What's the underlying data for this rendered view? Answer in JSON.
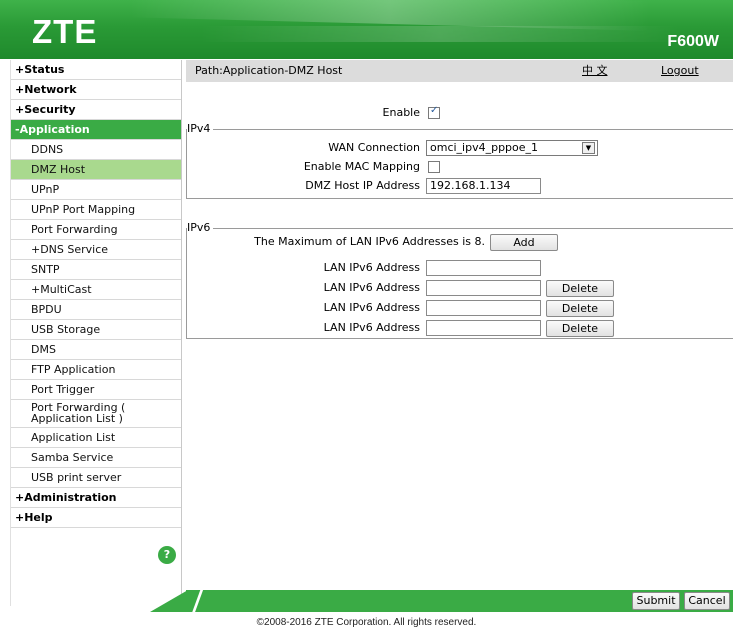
{
  "header": {
    "logo": "ZTE",
    "model": "F600W"
  },
  "sidebar": {
    "items": [
      {
        "label": "+Status",
        "level": "top"
      },
      {
        "label": "+Network",
        "level": "top"
      },
      {
        "label": "+Security",
        "level": "top"
      },
      {
        "label": "-Application",
        "level": "top",
        "active": true
      },
      {
        "label": "DDNS",
        "level": "sub"
      },
      {
        "label": "DMZ Host",
        "level": "sub",
        "selected": true
      },
      {
        "label": "UPnP",
        "level": "sub"
      },
      {
        "label": "UPnP Port Mapping",
        "level": "sub"
      },
      {
        "label": "Port Forwarding",
        "level": "sub"
      },
      {
        "label": "+DNS Service",
        "level": "sub"
      },
      {
        "label": "SNTP",
        "level": "sub"
      },
      {
        "label": "+MultiCast",
        "level": "sub"
      },
      {
        "label": "BPDU",
        "level": "sub"
      },
      {
        "label": "USB Storage",
        "level": "sub"
      },
      {
        "label": "DMS",
        "level": "sub"
      },
      {
        "label": "FTP Application",
        "level": "sub"
      },
      {
        "label": "Port Trigger",
        "level": "sub"
      },
      {
        "label": "Port Forwarding ( Application List )",
        "level": "sub"
      },
      {
        "label": "Application List",
        "level": "sub"
      },
      {
        "label": "Samba Service",
        "level": "sub"
      },
      {
        "label": "USB print server",
        "level": "sub"
      },
      {
        "label": "+Administration",
        "level": "top"
      },
      {
        "label": "+Help",
        "level": "top"
      }
    ],
    "help_icon": "?"
  },
  "pathbar": {
    "path": "Path:Application-DMZ Host",
    "language": "中 文",
    "logout": "Logout"
  },
  "form": {
    "enable_label": "Enable",
    "enable_checked": true,
    "ipv4": {
      "legend": "IPv4",
      "wan_label": "WAN Connection",
      "wan_value": "omci_ipv4_pppoe_1",
      "mac_label": "Enable MAC Mapping",
      "mac_checked": false,
      "dmz_label": "DMZ Host IP Address",
      "dmz_value": "192.168.1.134"
    },
    "ipv6": {
      "legend": "IPv6",
      "max_text": "The Maximum of LAN IPv6 Addresses is 8.",
      "add_label": "Add",
      "addr_label": "LAN IPv6 Address",
      "delete_label": "Delete",
      "rows": [
        {
          "value": "",
          "has_delete": false
        },
        {
          "value": "",
          "has_delete": true
        },
        {
          "value": "",
          "has_delete": true
        },
        {
          "value": "",
          "has_delete": true
        }
      ]
    }
  },
  "footer": {
    "submit": "Submit",
    "cancel": "Cancel",
    "copyright": "©2008-2016 ZTE Corporation. All rights reserved."
  },
  "colors": {
    "brand_green": "#3aab45",
    "selected_item": "#a9d98e",
    "path_bar": "#dcdcdc"
  }
}
